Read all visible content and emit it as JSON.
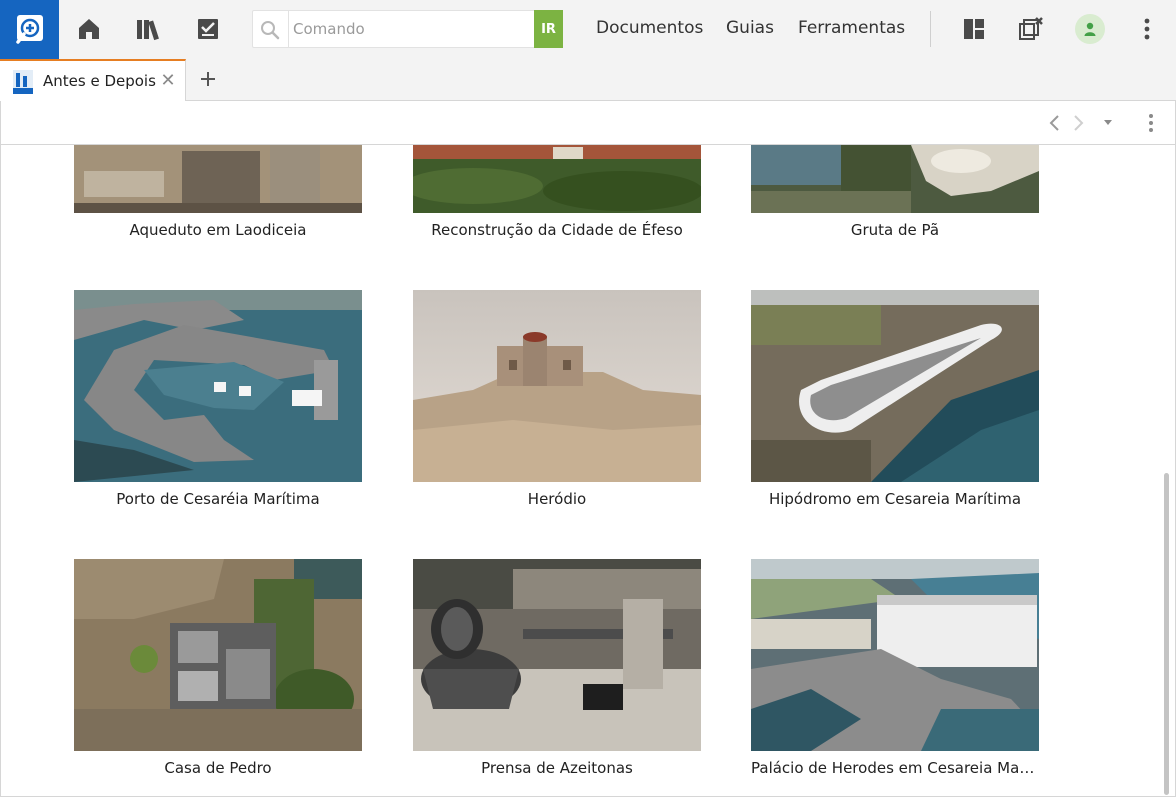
{
  "app": {
    "logo_icon": "logos-search-book-icon",
    "accent_color": "#1565c0",
    "go_color": "#7cb342",
    "tab_accent": "#e67e22"
  },
  "toolbar": {
    "home_icon": "home-icon",
    "library_icon": "library-icon",
    "checklist_icon": "checklist-icon",
    "search": {
      "placeholder": "Comando",
      "value": "",
      "go_label": "IR"
    },
    "menu": {
      "documents": "Documentos",
      "guides": "Guias",
      "tools": "Ferramentas"
    },
    "layout_icon": "layout-icon",
    "close_panels_icon": "close-panels-icon",
    "user_icon": "user-icon",
    "more_icon": "more-vertical-icon"
  },
  "tabs": [
    {
      "label": "Antes e Depois",
      "icon": "resource-icon",
      "active": true
    }
  ],
  "gallery": {
    "items": [
      {
        "caption": "Aqueduto em Laodiceia"
      },
      {
        "caption": "Reconstrução da Cidade de Éfeso"
      },
      {
        "caption": "Gruta de Pã"
      },
      {
        "caption": "Porto de Cesaréia Marítima"
      },
      {
        "caption": "Heródio"
      },
      {
        "caption": "Hipódromo em Cesareia Marítima"
      },
      {
        "caption": "Casa de Pedro"
      },
      {
        "caption": "Prensa de Azeitonas"
      },
      {
        "caption": "Palácio de Herodes em Cesareia Marítima"
      }
    ]
  }
}
